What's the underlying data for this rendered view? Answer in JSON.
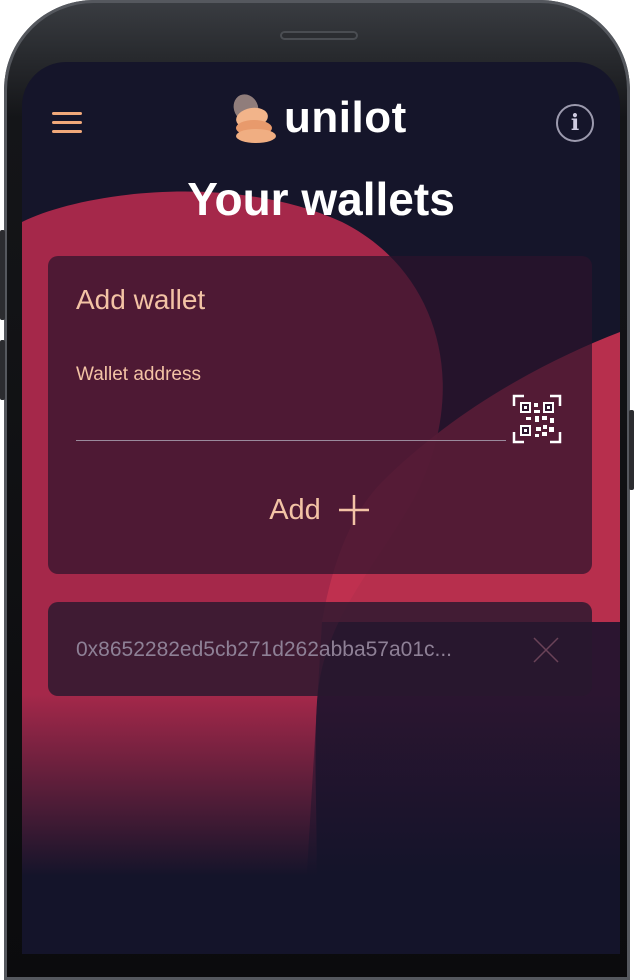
{
  "app": {
    "brand_name": "unilot"
  },
  "header": {
    "menu_icon": "hamburger-menu-icon",
    "info_icon": "info-icon",
    "info_glyph": "i"
  },
  "page": {
    "title": "Your wallets"
  },
  "add_wallet": {
    "title": "Add wallet",
    "field_label": "Wallet address",
    "field_value": "",
    "qr_icon": "qr-code-scan-icon",
    "add_label": "Add",
    "add_icon": "plus-icon"
  },
  "wallets": [
    {
      "address": "0x8652282ed5cb271d262abba57a01c...",
      "remove_icon": "close-icon"
    }
  ],
  "colors": {
    "background": "#15152a",
    "accent_blob": "#b52a4e",
    "text_accent": "#f3c3a5",
    "card": "#2c142c"
  }
}
